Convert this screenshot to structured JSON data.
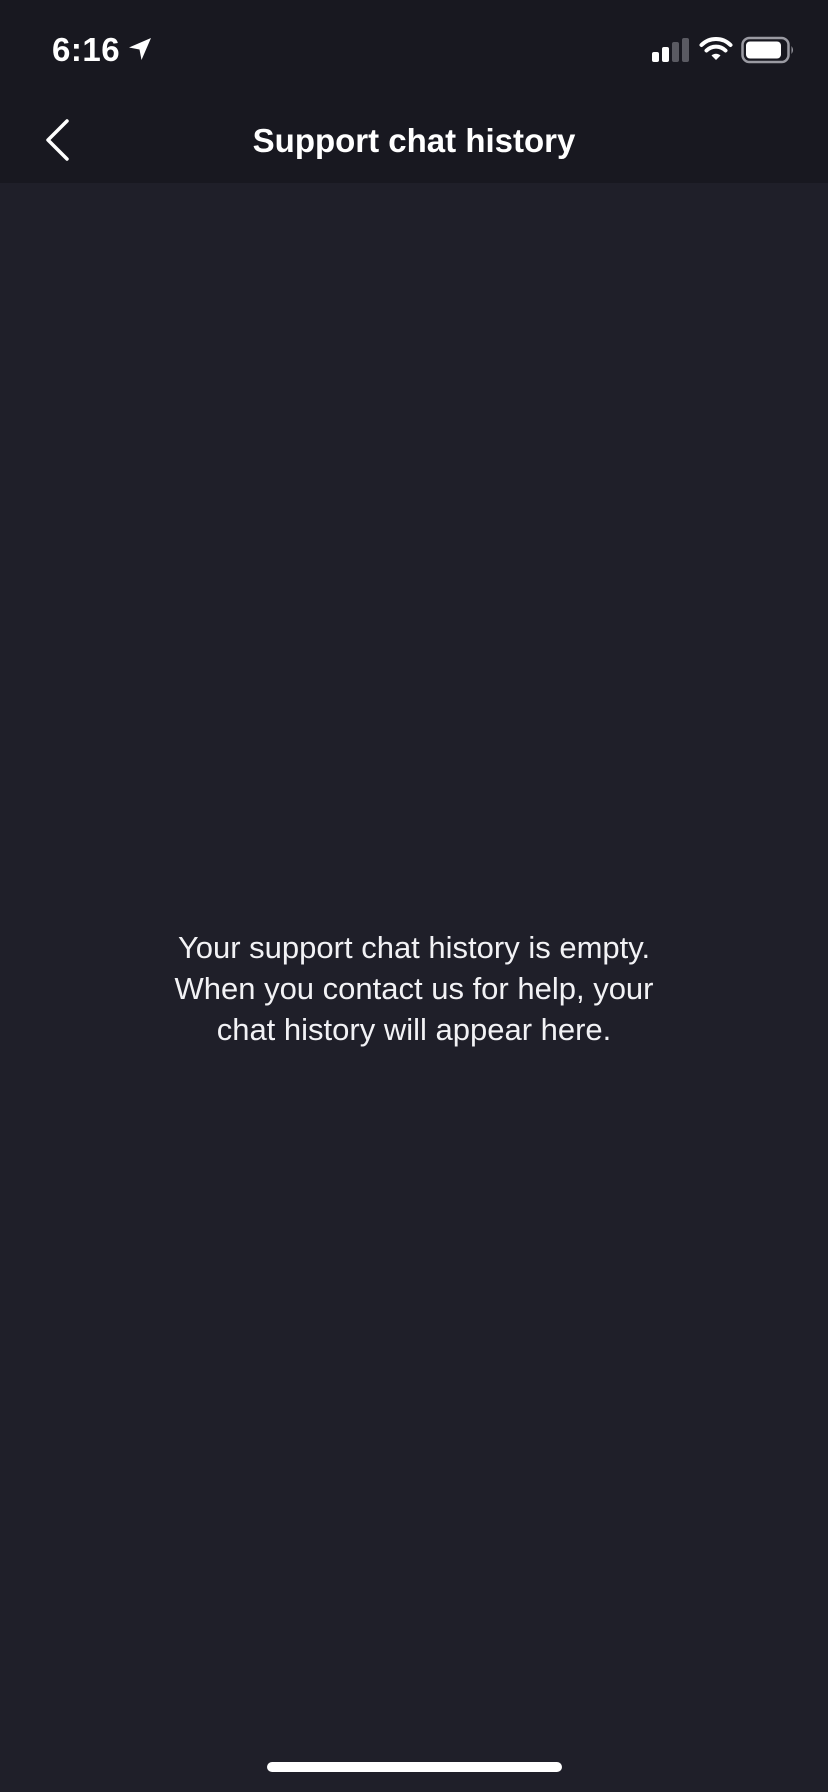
{
  "status_bar": {
    "time": "6:16",
    "icons": [
      "location-arrow-icon",
      "cellular-signal-icon",
      "wifi-icon",
      "battery-icon"
    ]
  },
  "header": {
    "title": "Support chat history",
    "back_icon": "chevron-left-icon"
  },
  "main": {
    "empty_message": "Your support chat history is empty.\nWhen you contact us for help, your\nchat history will appear here."
  },
  "colors": {
    "header_background": "#181820",
    "content_background": "#1f1f29",
    "text": "#ffffff"
  }
}
